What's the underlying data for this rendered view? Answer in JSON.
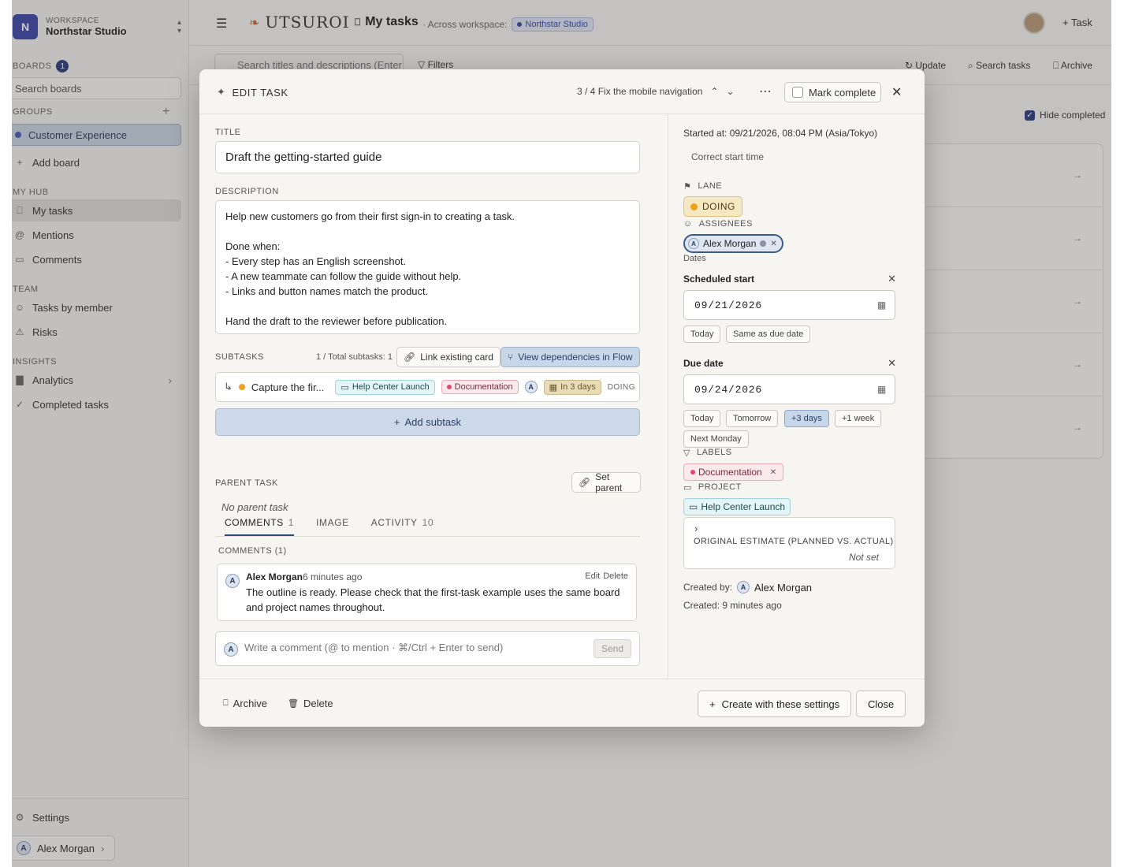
{
  "sidebar": {
    "workspace_label": "WORKSPACE",
    "workspace_name": "Northstar Studio",
    "workspace_initial": "N",
    "boards_heading": "BOARDS",
    "boards_count": "1",
    "search_placeholder": "Search boards",
    "groups_heading": "GROUPS",
    "group_item": "Customer Experience",
    "add_board": "Add board",
    "myhub_heading": "MY HUB",
    "myhub_items": [
      "My tasks",
      "Mentions",
      "Comments"
    ],
    "team_heading": "TEAM",
    "team_items": [
      "Tasks by member",
      "Risks"
    ],
    "insights_heading": "INSIGHTS",
    "insights_items": [
      "Analytics",
      "Completed tasks"
    ],
    "settings": "Settings",
    "user_name": "Alex Morgan",
    "user_initial": "A"
  },
  "topbar": {
    "brand": "UTSUROI",
    "page_title": "My tasks",
    "scope_text": "· Across workspace:",
    "scope_pill": "Northstar Studio",
    "new_task": "Task"
  },
  "toolbar": {
    "search_placeholder": "Search titles and descriptions (Enter",
    "filters": "Filters",
    "update": "Update",
    "search_tasks": "Search tasks",
    "archive": "Archive",
    "hide_completed": "Hide completed"
  },
  "modal": {
    "header_title": "EDIT TASK",
    "position": "3 / 4",
    "nav_task_name": "Fix the mobile navigation",
    "mark_complete": "Mark complete",
    "title_label": "TITLE",
    "title_value": "Draft the getting-started guide",
    "description_label": "DESCRIPTION",
    "description_value": "Help new customers go from their first sign-in to creating a task.\n\nDone when:\n- Every step has an English screenshot.\n- A new teammate can follow the guide without help.\n- Links and button names match the product.\n\nHand the draft to the reviewer before publication.",
    "subtasks_label": "SUBTASKS",
    "subtasks_count": "1 / Total subtasks: 1",
    "link_existing": "Link existing card",
    "view_dependencies": "View dependencies in Flow",
    "subtask": {
      "title": "Capture the fir...",
      "project": "Help Center Launch",
      "label": "Documentation",
      "assignee_initial": "A",
      "due": "In 3 days",
      "status": "DOING",
      "status_color": "#f0a020"
    },
    "add_subtask": "Add subtask",
    "parent_label": "PARENT TASK",
    "set_parent": "Set parent",
    "no_parent": "No parent task",
    "tabs": [
      {
        "label": "COMMENTS",
        "count": "1"
      },
      {
        "label": "IMAGE",
        "count": ""
      },
      {
        "label": "ACTIVITY",
        "count": "10"
      }
    ],
    "comments_heading": "COMMENTS (1)",
    "comment": {
      "author": "Alex Morgan",
      "time": "6 minutes ago",
      "edit": "Edit",
      "delete": "Delete",
      "text": "The outline is ready. Please check that the first-task example uses the same board and project names throughout."
    },
    "write_placeholder": "Write a comment (@ to mention · ⌘/Ctrl + Enter to send)",
    "send": "Send",
    "right": {
      "started_at": "Started at: 09/21/2026, 08:04 PM (Asia/Tokyo)",
      "correct_start": "Correct start time",
      "lane_label": "LANE",
      "lane_value": "DOING",
      "assignees_label": "ASSIGNEES",
      "assignee_name": "Alex Morgan",
      "dates_label": "Dates",
      "scheduled_start_label": "Scheduled start",
      "scheduled_start_value": "09/21/2026",
      "start_quick": [
        "Today",
        "Same as due date"
      ],
      "due_label": "Due date",
      "due_value": "09/24/2026",
      "due_quick": [
        "Today",
        "Tomorrow",
        "+3 days",
        "+1 week",
        "Next Monday"
      ],
      "labels_label": "LABELS",
      "label_value": "Documentation",
      "project_label": "PROJECT",
      "project_value": "Help Center Launch",
      "estimate_label": "ORIGINAL ESTIMATE (PLANNED VS. ACTUAL)",
      "estimate_value": "Not set",
      "created_by_label": "Created by:",
      "created_by_name": "Alex Morgan",
      "created": "Created: 9 minutes ago"
    },
    "footer": {
      "archive": "Archive",
      "delete": "Delete",
      "create_with_settings": "Create with these settings",
      "close": "Close"
    }
  },
  "colors": {
    "accent": "#2f3a7a",
    "lane_dot": "#f0a020",
    "label_dot": "#e04a6a",
    "group_dot": "#4a5ab8"
  }
}
